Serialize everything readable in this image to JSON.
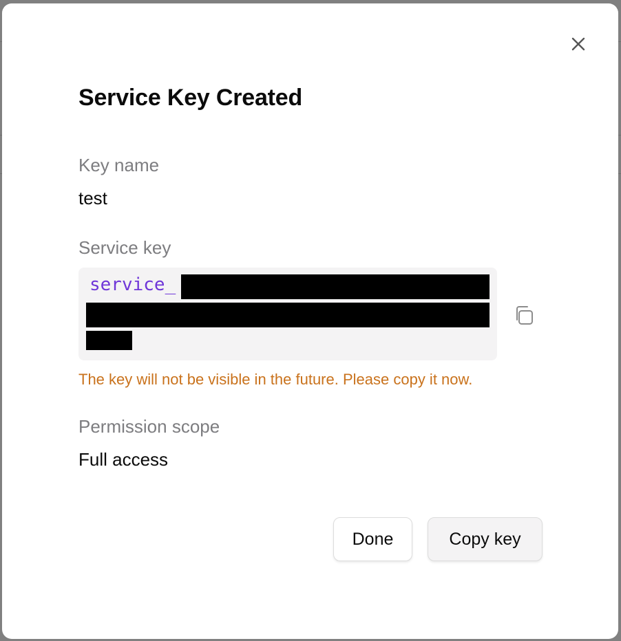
{
  "dialog": {
    "title": "Service Key Created",
    "close_icon": "close-icon",
    "key_name_label": "Key name",
    "key_name_value": "test",
    "service_key_label": "Service key",
    "service_key_prefix": "service_",
    "copy_icon": "copy-icon",
    "warning": "The key will not be visible in the future. Please copy it now.",
    "permission_label": "Permission scope",
    "permission_value": "Full access",
    "done_label": "Done",
    "copy_key_label": "Copy key"
  },
  "colors": {
    "warning": "#c9721c",
    "key_prefix": "#6f36d8",
    "label": "#7d7d80",
    "key_box_bg": "#f4f3f4"
  }
}
